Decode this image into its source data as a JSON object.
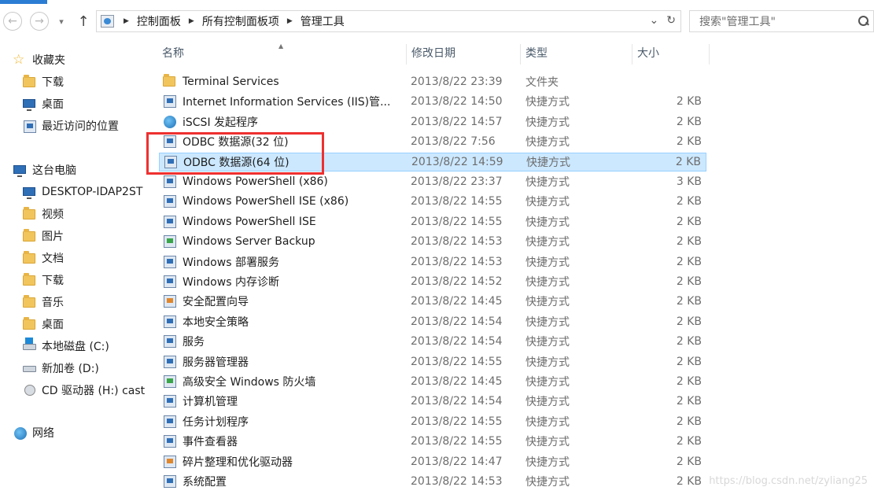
{
  "address": {
    "crumbs": [
      "控制面板",
      "所有控制面板项",
      "管理工具"
    ]
  },
  "search": {
    "placeholder": "搜索\"管理工具\""
  },
  "sidebar": {
    "favorites": {
      "label": "收藏夹",
      "items": [
        "下载",
        "桌面",
        "最近访问的位置"
      ]
    },
    "pc": {
      "label": "这台电脑",
      "items": [
        "DESKTOP-IDAP2ST",
        "视频",
        "图片",
        "文档",
        "下载",
        "音乐",
        "桌面",
        "本地磁盘 (C:)",
        "新加卷 (D:)",
        "CD 驱动器 (H:) cast"
      ]
    },
    "network": {
      "label": "网络"
    }
  },
  "columns": {
    "name": "名称",
    "date": "修改日期",
    "type": "类型",
    "size": "大小"
  },
  "files": [
    {
      "name": "Terminal Services",
      "date": "2013/8/22 23:39",
      "type": "文件夹",
      "size": ""
    },
    {
      "name": "Internet Information Services (IIS)管...",
      "date": "2013/8/22 14:50",
      "type": "快捷方式",
      "size": "2 KB"
    },
    {
      "name": "iSCSI 发起程序",
      "date": "2013/8/22 14:57",
      "type": "快捷方式",
      "size": "2 KB"
    },
    {
      "name": "ODBC 数据源(32 位)",
      "date": "2013/8/22 7:56",
      "type": "快捷方式",
      "size": "2 KB"
    },
    {
      "name": "ODBC 数据源(64 位)",
      "date": "2013/8/22 14:59",
      "type": "快捷方式",
      "size": "2 KB"
    },
    {
      "name": "Windows PowerShell (x86)",
      "date": "2013/8/22 23:37",
      "type": "快捷方式",
      "size": "3 KB"
    },
    {
      "name": "Windows PowerShell ISE (x86)",
      "date": "2013/8/22 14:55",
      "type": "快捷方式",
      "size": "2 KB"
    },
    {
      "name": "Windows PowerShell ISE",
      "date": "2013/8/22 14:55",
      "type": "快捷方式",
      "size": "2 KB"
    },
    {
      "name": "Windows Server Backup",
      "date": "2013/8/22 14:53",
      "type": "快捷方式",
      "size": "2 KB"
    },
    {
      "name": "Windows 部署服务",
      "date": "2013/8/22 14:53",
      "type": "快捷方式",
      "size": "2 KB"
    },
    {
      "name": "Windows 内存诊断",
      "date": "2013/8/22 14:52",
      "type": "快捷方式",
      "size": "2 KB"
    },
    {
      "name": "安全配置向导",
      "date": "2013/8/22 14:45",
      "type": "快捷方式",
      "size": "2 KB"
    },
    {
      "name": "本地安全策略",
      "date": "2013/8/22 14:54",
      "type": "快捷方式",
      "size": "2 KB"
    },
    {
      "name": "服务",
      "date": "2013/8/22 14:54",
      "type": "快捷方式",
      "size": "2 KB"
    },
    {
      "name": "服务器管理器",
      "date": "2013/8/22 14:55",
      "type": "快捷方式",
      "size": "2 KB"
    },
    {
      "name": "高级安全 Windows 防火墙",
      "date": "2013/8/22 14:45",
      "type": "快捷方式",
      "size": "2 KB"
    },
    {
      "name": "计算机管理",
      "date": "2013/8/22 14:54",
      "type": "快捷方式",
      "size": "2 KB"
    },
    {
      "name": "任务计划程序",
      "date": "2013/8/22 14:55",
      "type": "快捷方式",
      "size": "2 KB"
    },
    {
      "name": "事件查看器",
      "date": "2013/8/22 14:55",
      "type": "快捷方式",
      "size": "2 KB"
    },
    {
      "name": "碎片整理和优化驱动器",
      "date": "2013/8/22 14:47",
      "type": "快捷方式",
      "size": "2 KB"
    },
    {
      "name": "系统配置",
      "date": "2013/8/22 14:53",
      "type": "快捷方式",
      "size": "2 KB"
    }
  ],
  "watermark": "https://blog.csdn.net/zyliang25",
  "colors": {
    "selection": "#cce8ff",
    "highlight_box": "#ee3030"
  }
}
